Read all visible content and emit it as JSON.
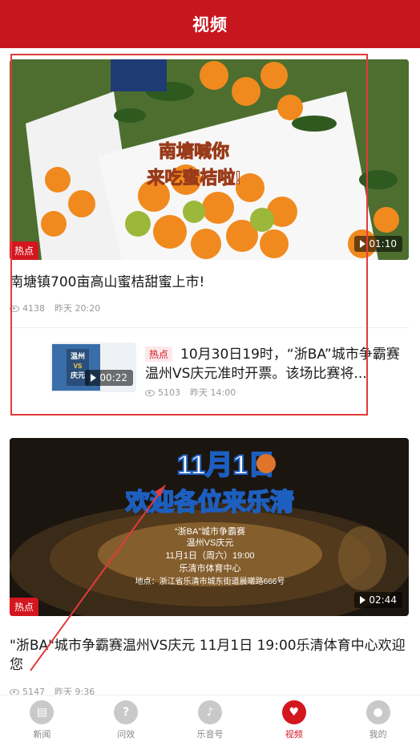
{
  "header": {
    "title": "视频"
  },
  "items": [
    {
      "overlay_text_line1": "南塘喊你",
      "overlay_text_line2": "来吃蜜桔啦!",
      "tag": "热点",
      "duration": "01:10",
      "title": "南塘镇700亩高山蜜桔甜蜜上市!",
      "views": "4138",
      "time": "昨天 20:20"
    },
    {
      "thumb_text1": "温州",
      "thumb_text2": "VS",
      "thumb_text3": "庆元",
      "tag": "热点",
      "duration": "00:22",
      "title": "10月30日19时，“浙BA”城市争霸赛温州VS庆元准时开票。该场比赛将...",
      "views": "5103",
      "time": "昨天 14:00"
    },
    {
      "overlay_big": "11月1日",
      "overlay_welcome": "欢迎各位来乐清",
      "overlay_l1": "“浙BA”城市争霸赛",
      "overlay_l2": "温州VS庆元",
      "overlay_l3": "11月1日（周六）19:00",
      "overlay_l4": "乐清市体育中心",
      "overlay_l5": "地点：浙江省乐清市城东街道晨曦路666号",
      "tag": "热点",
      "duration": "02:44",
      "title": "\"浙BA\"城市争霸赛温州VS庆元 11月1日 19:00乐清体育中心欢迎您",
      "views": "5147",
      "time": "昨天 9:36"
    }
  ],
  "tabs": [
    {
      "label": "新闻",
      "icon": "news-icon"
    },
    {
      "label": "问效",
      "icon": "question-icon"
    },
    {
      "label": "乐音号",
      "icon": "leyin-icon"
    },
    {
      "label": "视频",
      "icon": "video-heart-icon",
      "active": true
    },
    {
      "label": "我的",
      "icon": "profile-icon"
    }
  ],
  "colors": {
    "brand": "#c8161e",
    "annotation": "#e23b3b"
  }
}
